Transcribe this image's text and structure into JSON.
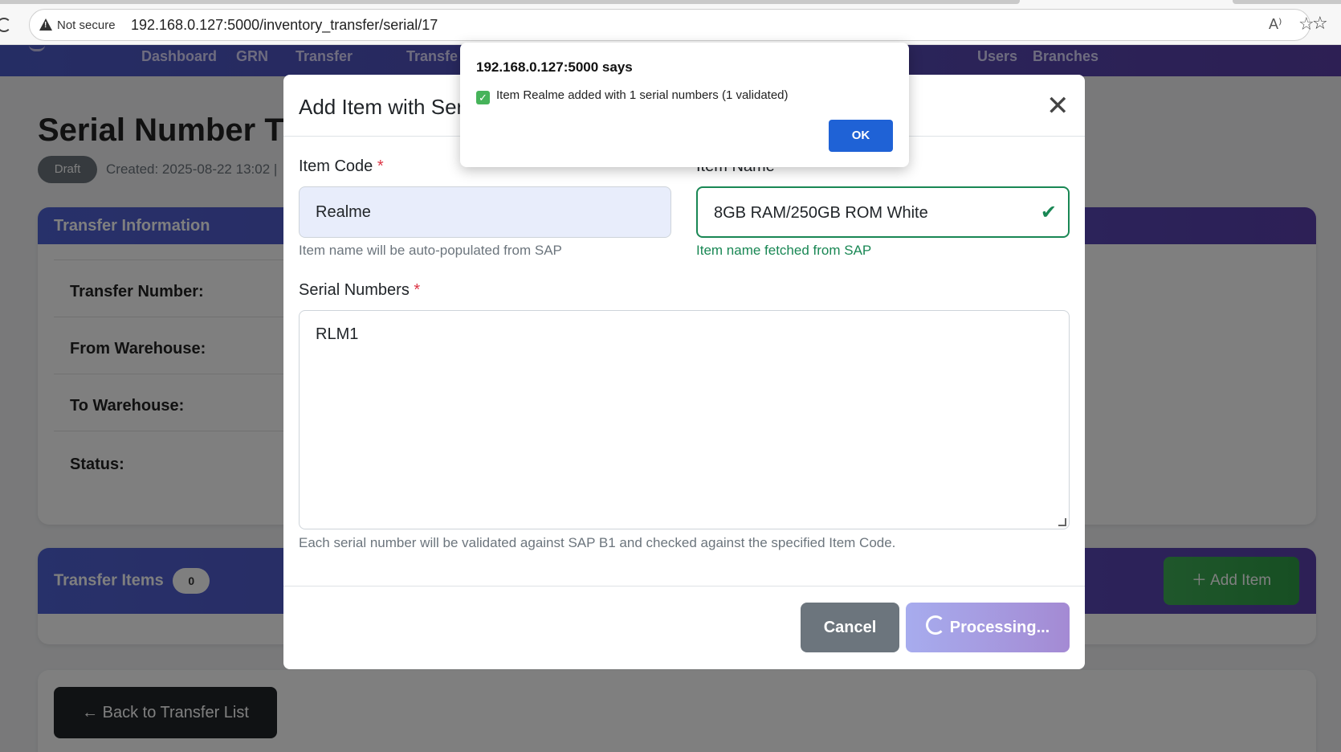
{
  "browser": {
    "security_label": "Not secure",
    "url": "192.168.0.127:5000/inventory_transfer/serial/17"
  },
  "nav": {
    "items": [
      "Dashboard",
      "GRN",
      "Transfer",
      "Transfe",
      "Users",
      "Branches"
    ]
  },
  "page": {
    "title": "Serial Number Tr",
    "status_badge": "Draft",
    "created": "Created: 2025-08-22 13:02 |"
  },
  "transfer_info": {
    "header": "Transfer Information",
    "rows": [
      "Transfer Number:",
      "From Warehouse:",
      "To Warehouse:",
      "Status:"
    ]
  },
  "transfer_items": {
    "header": "Transfer Items",
    "count": "0",
    "add_label": "Add Item"
  },
  "back_button": "Back to Transfer List",
  "modal": {
    "title": "Add Item with Ser",
    "item_code_label": "Item Code",
    "item_code_value": "Realme",
    "item_code_help": "Item name will be auto-populated from SAP",
    "item_name_label": "Item Name",
    "item_name_value": "8GB RAM/250GB ROM White",
    "item_name_help": "Item name fetched from SAP",
    "serials_label": "Serial Numbers",
    "serials_value": "RLM1",
    "serials_help": "Each serial number will be validated against SAP B1 and checked against the specified Item Code.",
    "cancel_label": "Cancel",
    "processing_label": "Processing...",
    "required_mark": "*"
  },
  "alert": {
    "title": "192.168.0.127:5000 says",
    "message": "Item Realme added with 1 serial numbers (1 validated)",
    "ok_label": "OK"
  },
  "colors": {
    "nav_gradient_start": "#4b5bc9",
    "nav_gradient_end": "#5a3fa8",
    "success": "#198754",
    "primary_button": "#1f62d6",
    "secondary_button": "#6c757d"
  }
}
